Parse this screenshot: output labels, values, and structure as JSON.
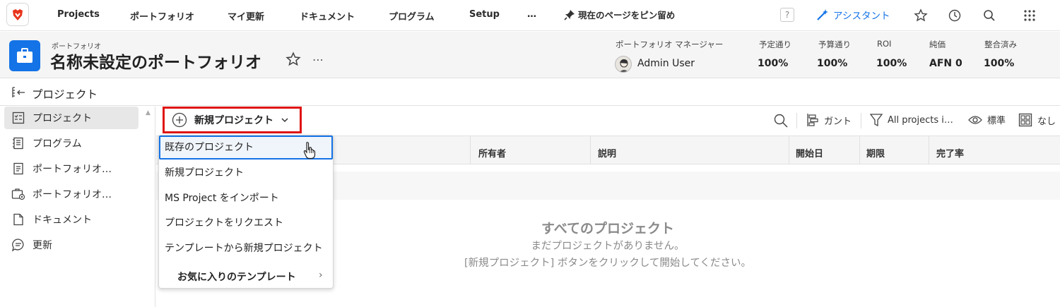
{
  "topnav": {
    "items": [
      "Projects",
      "ポートフォリオ",
      "マイ更新",
      "ドキュメント",
      "プログラム",
      "Setup",
      "…"
    ],
    "pin_label": "現在のページをピン留め",
    "help_label": "?",
    "assistant_label": "アシスタント"
  },
  "header": {
    "breadcrumb": "ポートフォリオ",
    "title": "名称未設定のポートフォリオ",
    "more": "⋯",
    "manager_label": "ポートフォリオ マネージャー",
    "manager_name": "Admin User",
    "metrics": [
      {
        "label": "予定通り",
        "value": "100%"
      },
      {
        "label": "予算通り",
        "value": "100%"
      },
      {
        "label": "ROI",
        "value": "100%"
      },
      {
        "label": "純価",
        "value": "AFN 0"
      },
      {
        "label": "整合済み",
        "value": "100%"
      }
    ]
  },
  "section": {
    "title": "プロジェクト"
  },
  "sidebar": {
    "items": [
      {
        "label": "プロジェクト",
        "icon": "project-list-icon",
        "active": true
      },
      {
        "label": "プログラム",
        "icon": "program-icon",
        "active": false
      },
      {
        "label": "ポートフォリオ…",
        "icon": "document-icon",
        "active": false
      },
      {
        "label": "ポートフォリオ…",
        "icon": "briefcase-settings-icon",
        "active": false
      },
      {
        "label": "ドキュメント",
        "icon": "file-icon",
        "active": false
      },
      {
        "label": "更新",
        "icon": "comment-icon",
        "active": false
      }
    ]
  },
  "toolbar": {
    "new_project": "新規プロジェクト",
    "gantt": "ガント",
    "filter": "All projects i…",
    "view": "標準",
    "grouping": "なし"
  },
  "table": {
    "columns": [
      "所有者",
      "説明",
      "開始日",
      "期限",
      "完了率"
    ]
  },
  "empty": {
    "title": "すべてのプロジェクト",
    "line1": "まだプロジェクトがありません。",
    "line2": "[新規プロジェクト] ボタンをクリックして開始してください。"
  },
  "dropdown": {
    "items": [
      "既存のプロジェクト",
      "新規プロジェクト",
      "MS Project をインポート",
      "プロジェクトをリクエスト",
      "テンプレートから新規プロジェクト"
    ],
    "favorites": "お気に入りのテンプレート",
    "chevron": "›"
  },
  "colors": {
    "accent": "#1473e6",
    "highlight_border": "#e01414",
    "logo_red": "#e8341c"
  }
}
